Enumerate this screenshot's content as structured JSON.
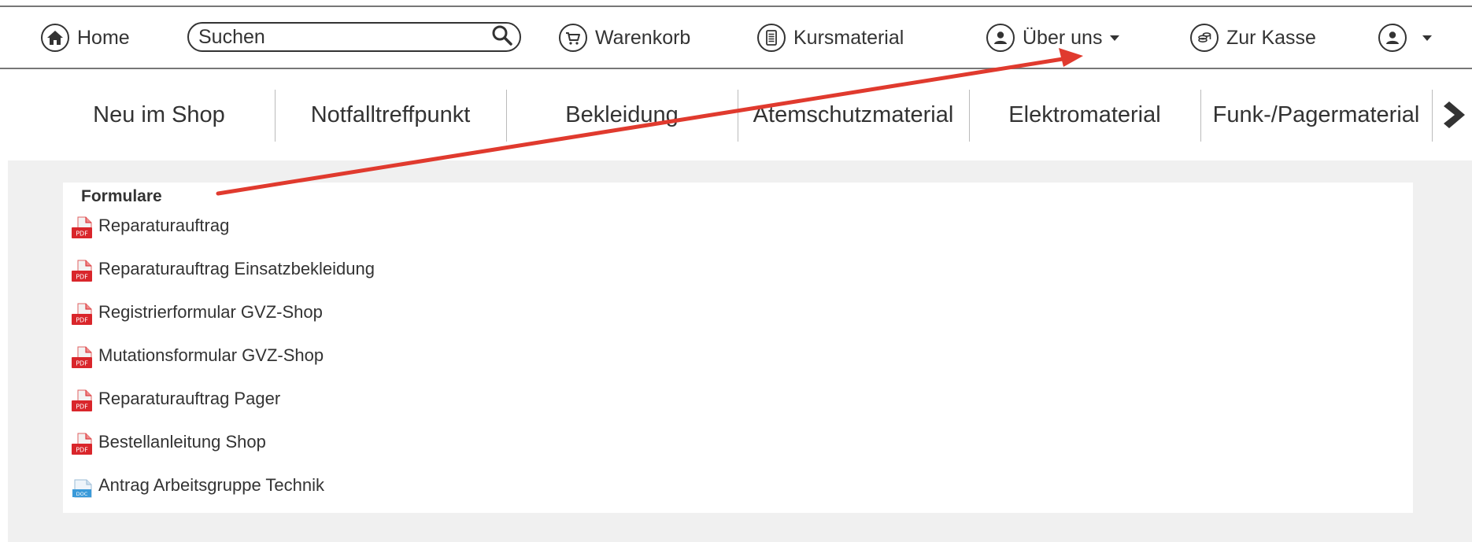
{
  "topnav": {
    "home_label": "Home",
    "search_placeholder": "Suchen",
    "cart_label": "Warenkorb",
    "course_label": "Kursmaterial",
    "about_label": "Über uns",
    "checkout_label": "Zur Kasse"
  },
  "categories": [
    "Neu im Shop",
    "Notfalltreffpunkt",
    "Bekleidung",
    "Atemschutzmaterial",
    "Elektromaterial",
    "Funk-/Pagermaterial"
  ],
  "forms": {
    "title": "Formulare",
    "items": [
      {
        "label": "Reparaturauftrag",
        "icon": "pdf-icon"
      },
      {
        "label": "Reparaturauftrag Einsatzbekleidung",
        "icon": "pdf-icon"
      },
      {
        "label": "Registrierformular GVZ-Shop",
        "icon": "pdf-icon"
      },
      {
        "label": "Mutationsformular GVZ-Shop",
        "icon": "pdf-icon"
      },
      {
        "label": "Reparaturauftrag Pager",
        "icon": "pdf-icon"
      },
      {
        "label": "Bestellanleitung Shop",
        "icon": "pdf-icon"
      },
      {
        "label": "Antrag Arbeitsgruppe Technik",
        "icon": "doc-icon"
      }
    ]
  },
  "colors": {
    "annotation_arrow": "#e03a2e",
    "pdf_red": "#d9262b",
    "doc_blue": "#3a9ad9",
    "content_bg": "#f0f0f0"
  }
}
